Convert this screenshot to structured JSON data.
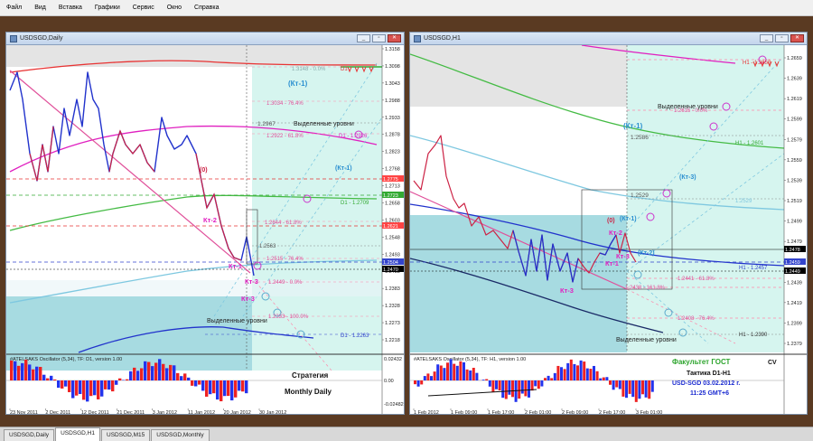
{
  "menu": [
    "Файл",
    "Вид",
    "Вставка",
    "Графики",
    "Сервис",
    "Окно",
    "Справка"
  ],
  "tabs": [
    {
      "label": "USDSGD,Daily",
      "active": false
    },
    {
      "label": "USDSGD,H1",
      "active": true
    },
    {
      "label": "USDSGD,M15",
      "active": false
    },
    {
      "label": "USDSGD,Monthly",
      "active": false
    }
  ],
  "left": {
    "title": "USDSGD,Daily",
    "prices": [
      "1.3158",
      "1.3098",
      "1.3043",
      "1.2988",
      "1.2933",
      "1.2878",
      "1.2823",
      "1.2768",
      "1.2713",
      "1.2658",
      "1.2603",
      "1.2548",
      "1.2493",
      "1.2438",
      "1.2383",
      "1.2328",
      "1.2273",
      "1.2218"
    ],
    "price_tags": [
      {
        "text": "1.2775",
        "color": "#ff4444"
      },
      {
        "text": "1.2723",
        "color": "#33aa33"
      },
      {
        "text": "1.2621",
        "color": "#ff4444"
      },
      {
        "text": "1.2504",
        "color": "#3344cc"
      },
      {
        "text": "1.2470",
        "color": "#000000"
      }
    ],
    "dates": [
      "23 Nov 2011",
      "2 Dec 2011",
      "12 Dec 2011",
      "21 Dec 2011",
      "3 Jan 2012",
      "11 Jan 2012",
      "20 Jan 2012",
      "30 Jan 2012"
    ],
    "labels": {
      "kt1_top": "(Кт-1)",
      "level_3148": "1.3148 - 0.0%",
      "d1_top": "D1",
      "level_3034": "1.3034 - 76.4%",
      "level_2967": "1.2967",
      "vydel_top": "Выделенные уровни",
      "level_2922": "1.2922 - 61.8%",
      "d1_2926": "D1 - 1.2926",
      "zero": "(0)",
      "kt1_mid": "(Кт-1)",
      "d1_2709": "D1 - 1.2709",
      "kt2": "Кт-2",
      "level_2644": "1.2644 - 61.8%",
      "level_2563": "1.2563",
      "level_2515": "1.2515 - 76.4%",
      "kt1_low": "Кт-1",
      "kt3a": "Кт-3",
      "level_2449": "1.2449 - 0.0%",
      "kt3b": "Кт-3",
      "level_2333": "1.2333 - 100.0%",
      "vydel_bot": "Выделенные уровни",
      "d1_2263": "D1 - 1.2263"
    },
    "osc": {
      "title": "#ATELSAKS Oscillator (5,34), TF: D1, version 1.00",
      "scale": [
        "0.02432",
        "0.00",
        "-0.02482"
      ],
      "strategy": "Стратегия",
      "monthly": "Monthly Daily"
    }
  },
  "right": {
    "title": "USDSGD,H1",
    "prices": [
      "1.2659",
      "1.2639",
      "1.2619",
      "1.2599",
      "1.2579",
      "1.2559",
      "1.2539",
      "1.2519",
      "1.2499",
      "1.2479",
      "1.2459",
      "1.2439",
      "1.2419",
      "1.2399",
      "1.2379"
    ],
    "price_tags": [
      {
        "text": "1.2478",
        "color": "#000000"
      },
      {
        "text": "1.2459",
        "color": "#3344cc"
      },
      {
        "text": "1.2449",
        "color": "#000000"
      }
    ],
    "dates": [
      "1 Feb 2012",
      "1 Feb 09:00",
      "1 Feb 17:00",
      "2 Feb 01:00",
      "2 Feb 09:00",
      "2 Feb 17:00",
      "3 Feb 01:00"
    ],
    "labels": {
      "h1_top": "H1 - 1.2653",
      "vydel_top": "Выделенные уровни",
      "kt1_top": "(Кт-1)",
      "level_2615": "1.2615 - 0.0%",
      "level_2586": "1.2586",
      "h1_2601": "H1 - 1.2601",
      "kt3_up": "(Кт-3)",
      "level_2529": "1.2529",
      "level_2529b": "1.2529",
      "zero": "(0)",
      "kt1_mid": "(Кт-1)",
      "kt2": "Кт-2",
      "kt2b": "(Кт-2)",
      "kt3a": "Кт-3",
      "kt1_low": "Кт-1",
      "h1_2457": "H1 - 1.2457",
      "level_2441": "1.2441 - 61.8%",
      "level_2438": "1.2438 - 161.8%",
      "kt3b": "Кт-3",
      "level_2408": "1.2408 - 76.4%",
      "h1_2390": "H1 - 1.2390",
      "vydel_bot": "Выделенные уровни"
    },
    "osc": {
      "title": "#ATELSAKS Oscillator (5,34), TF: H1, version 1.00",
      "faculty": "Факультет ГОСТ",
      "cv": "CV",
      "tactic": "Тактика D1-H1",
      "pair_date": "USD-SGD  03.02.2012 г.",
      "time": "11:25  GMT+6"
    }
  },
  "colors": {
    "bg": "#5a3a22",
    "cyan_zone": "#d6f5ef",
    "teal_zone": "#a7dbe1",
    "gray_zone": "#e4e4e4"
  }
}
